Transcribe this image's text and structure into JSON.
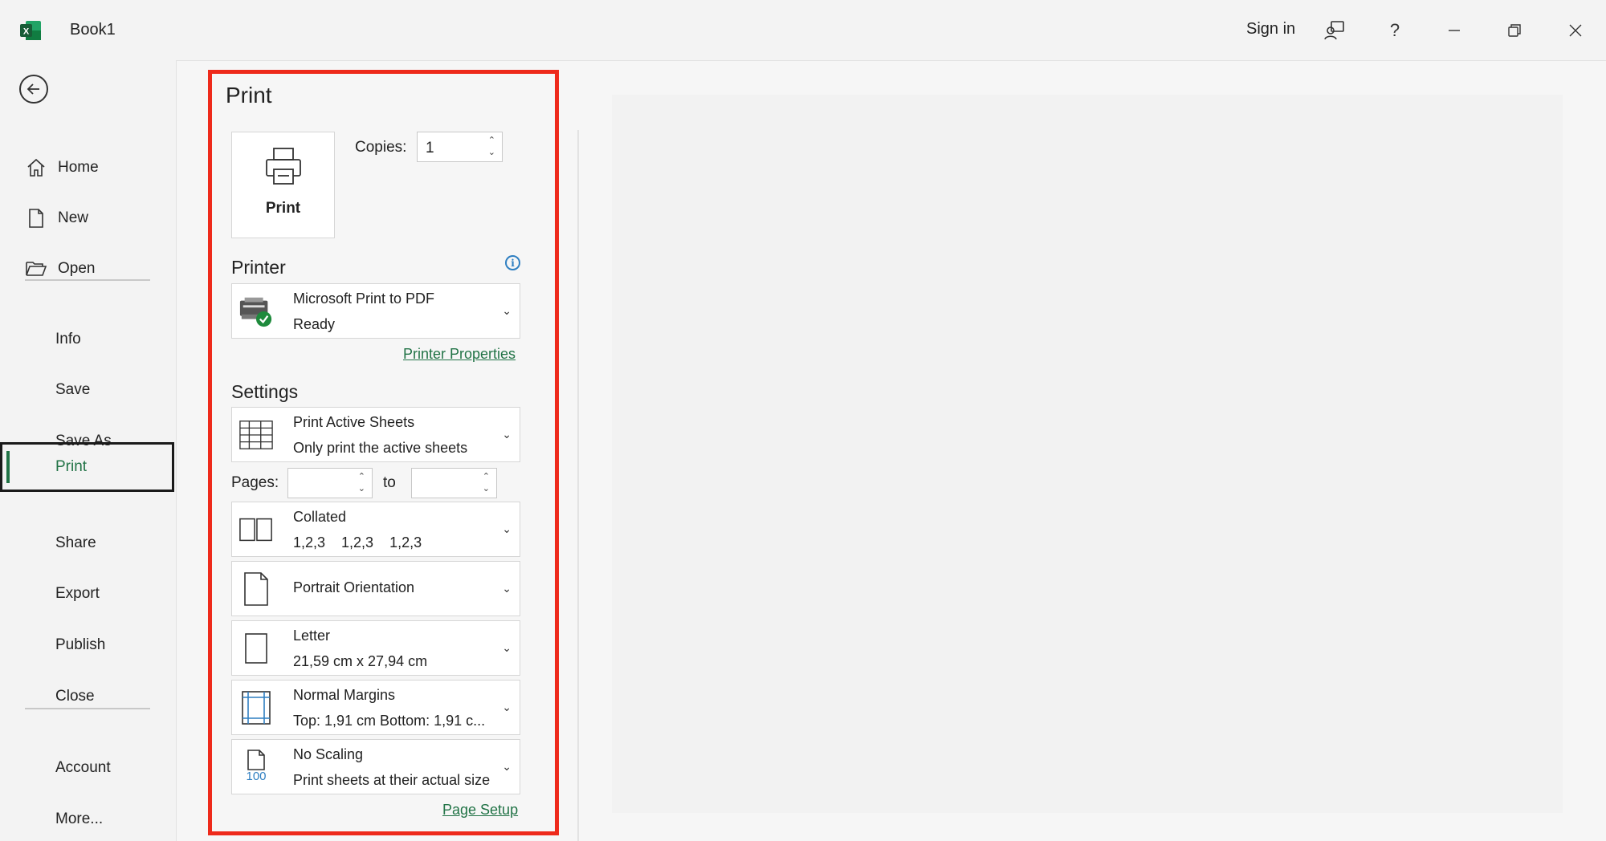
{
  "titlebar": {
    "doc_title": "Book1",
    "sign_in": "Sign in",
    "help": "?",
    "accent": "#217346"
  },
  "sidebar": {
    "items": [
      {
        "label": "Home",
        "icon": "home-icon"
      },
      {
        "label": "New",
        "icon": "new-document-icon"
      },
      {
        "label": "Open",
        "icon": "open-folder-icon"
      },
      {
        "label": "Info"
      },
      {
        "label": "Save"
      },
      {
        "label": "Save As"
      },
      {
        "label": "Print"
      },
      {
        "label": "Share"
      },
      {
        "label": "Export"
      },
      {
        "label": "Publish"
      },
      {
        "label": "Close"
      },
      {
        "label": "Account"
      },
      {
        "label": "More..."
      }
    ],
    "active": "Print"
  },
  "print_panel": {
    "title": "Print",
    "print_button": "Print",
    "copies_label": "Copies:",
    "copies_value": "1",
    "printer_heading": "Printer",
    "printer_name": "Microsoft Print to PDF",
    "printer_status": "Ready",
    "printer_properties": "Printer Properties",
    "settings_heading": "Settings",
    "what_to_print": {
      "title": "Print Active Sheets",
      "subtitle": "Only print the active sheets"
    },
    "pages_label": "Pages:",
    "to_label": "to",
    "collation": {
      "title": "Collated",
      "subtitle": "1,2,3    1,2,3    1,2,3"
    },
    "orientation": {
      "title": "Portrait Orientation"
    },
    "paper": {
      "title": "Letter",
      "subtitle": "21,59 cm x 27,94 cm"
    },
    "margins": {
      "title": "Normal Margins",
      "subtitle": "Top: 1,91 cm Bottom: 1,91 c..."
    },
    "scaling": {
      "title": "No Scaling",
      "subtitle": "Print sheets at their actual size",
      "icon_text": "100"
    },
    "page_setup": "Page Setup"
  }
}
